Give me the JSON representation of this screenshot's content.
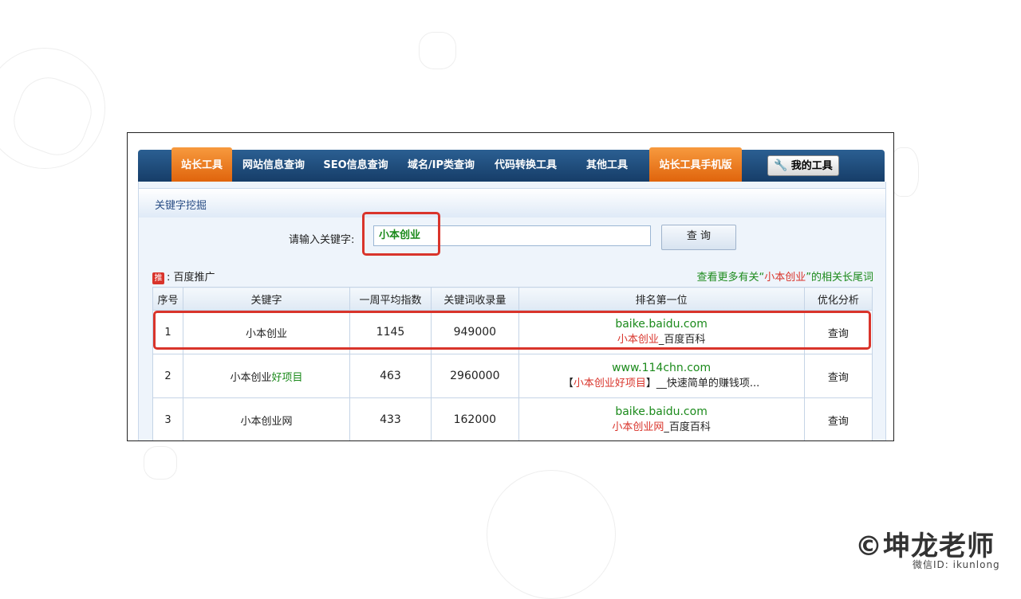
{
  "nav": {
    "items": [
      "站长工具",
      "网站信息查询",
      "SEO信息查询",
      "域名/IP类查询",
      "代码转换工具",
      "其他工具",
      "站长工具手机版"
    ],
    "my_tools": "我的工具"
  },
  "panel": {
    "title": "关键字挖掘"
  },
  "search": {
    "label": "请输入关键字:",
    "value": "小本创业",
    "button": "查 询"
  },
  "promo": {
    "badge": "推",
    "text": ":  百度推广"
  },
  "more_link": {
    "prefix": "查看更多有关“",
    "keyword": "小本创业",
    "suffix": "”的相关长尾词"
  },
  "table": {
    "headers": [
      "序号",
      "关键字",
      "一周平均指数",
      "关键词收录量",
      "排名第一位",
      "优化分析"
    ],
    "rows": [
      {
        "index": "1",
        "keyword": "小本创业",
        "keyword_suffix": "",
        "weekly_index": "1145",
        "indexed": "949000",
        "site": "baike.baidu.com",
        "desc_prefix": "",
        "desc_kw": "小本创业",
        "desc_suffix": "_百度百科",
        "action": "查询"
      },
      {
        "index": "2",
        "keyword": "小本创业",
        "keyword_suffix": "好项目",
        "weekly_index": "463",
        "indexed": "2960000",
        "site": "www.114chn.com",
        "desc_prefix": "【",
        "desc_kw": "小本创业好项目",
        "desc_suffix": "】__快速简单的赚钱项...",
        "action": "查询"
      },
      {
        "index": "3",
        "keyword": "小本创业",
        "keyword_suffix": "网",
        "weekly_index": "433",
        "indexed": "162000",
        "site": "baike.baidu.com",
        "desc_prefix": "",
        "desc_kw": "小本创业网",
        "desc_suffix": "_百度百科",
        "action": "查询"
      }
    ]
  },
  "watermark": {
    "logo": "©坤龙老师",
    "wechat": "微信ID: ikunlong"
  },
  "colors": {
    "accent_orange": "#e8761f",
    "nav_blue": "#1f4c7c",
    "highlight_red": "#d9342b",
    "green": "#1b8a1b"
  }
}
